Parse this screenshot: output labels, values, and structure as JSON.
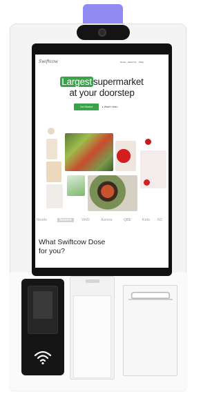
{
  "screen": {
    "logo": "Swiftcow",
    "nav": [
      "Home",
      "About Us",
      "Shop"
    ],
    "hero": {
      "highlight": "Largest",
      "line1_rest": "supermarket",
      "line2": "at your doorstep"
    },
    "cta_primary": "Get Started",
    "cta_secondary": "Watch Video",
    "brands": [
      "Nestle",
      "Seismo",
      "VAIO",
      "Aurora",
      "QBE",
      "Kolo",
      "NC"
    ],
    "about_heading_line1": "What Swiftcow Dose",
    "about_heading_line2": "for you?"
  },
  "colors": {
    "accent_green": "#3aa34a",
    "camera_light": "#8f8bf2",
    "bezel": "#111111"
  },
  "icons": {
    "nfc": "wifi-contactless-icon",
    "camera": "camera-icon"
  }
}
